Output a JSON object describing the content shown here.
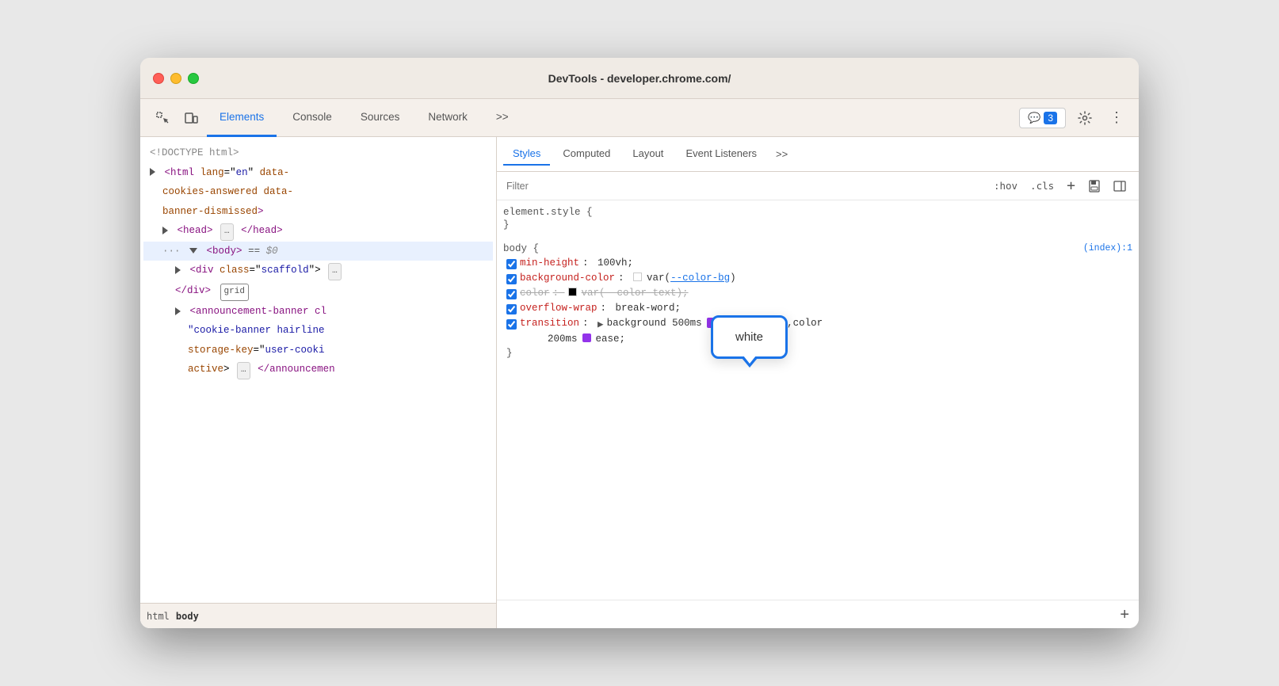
{
  "window": {
    "title": "DevTools - developer.chrome.com/"
  },
  "toolbar": {
    "tabs": [
      {
        "label": "Elements",
        "active": true
      },
      {
        "label": "Console",
        "active": false
      },
      {
        "label": "Sources",
        "active": false
      },
      {
        "label": "Network",
        "active": false
      },
      {
        "label": ">>",
        "active": false
      }
    ],
    "messages_count": "3",
    "messages_label": "3"
  },
  "elements_panel": {
    "lines": [
      {
        "text": "<!DOCTYPE html>",
        "class": "html-doctype",
        "indent": 0
      },
      {
        "text": "html",
        "indent": 0
      },
      {
        "text": "head",
        "indent": 1
      },
      {
        "text": "body",
        "indent": 1
      },
      {
        "text": "div",
        "indent": 2
      },
      {
        "text": "/div",
        "indent": 2
      },
      {
        "text": "announcement-banner",
        "indent": 2
      }
    ]
  },
  "styles_panel": {
    "tabs": [
      {
        "label": "Styles",
        "active": true
      },
      {
        "label": "Computed",
        "active": false
      },
      {
        "label": "Layout",
        "active": false
      },
      {
        "label": "Event Listeners",
        "active": false
      },
      {
        "label": ">>",
        "active": false
      }
    ],
    "filter_placeholder": "Filter",
    "filter_actions": {
      "hov": ":hov",
      "cls": ".cls",
      "plus": "+",
      "save_icon": "💾",
      "layout_icon": "⬚"
    },
    "rules": [
      {
        "selector": "element.style {",
        "closing": "}",
        "source": "",
        "properties": []
      },
      {
        "selector": "body {",
        "closing": "}",
        "source": "(index):1",
        "properties": [
          {
            "checked": true,
            "name": "min-height",
            "value": "100vh",
            "swatch": null,
            "strikethrough": false
          },
          {
            "checked": true,
            "name": "background-color",
            "value": "var(--color-bg)",
            "swatch": "white",
            "strikethrough": false
          },
          {
            "checked": true,
            "name": "color",
            "value": "var(--color-text)",
            "swatch": "black",
            "strikethrough": false
          },
          {
            "checked": true,
            "name": "overflow-wrap",
            "value": "break-word",
            "swatch": null,
            "strikethrough": false
          },
          {
            "checked": true,
            "name": "transition",
            "value": "background 500ms ease-in-out,color 200ms ease",
            "swatch": null,
            "strikethrough": false
          }
        ]
      }
    ]
  },
  "tooltip": {
    "text": "white"
  },
  "breadcrumb": {
    "items": [
      {
        "label": "html",
        "active": false
      },
      {
        "label": "body",
        "active": true
      }
    ]
  }
}
